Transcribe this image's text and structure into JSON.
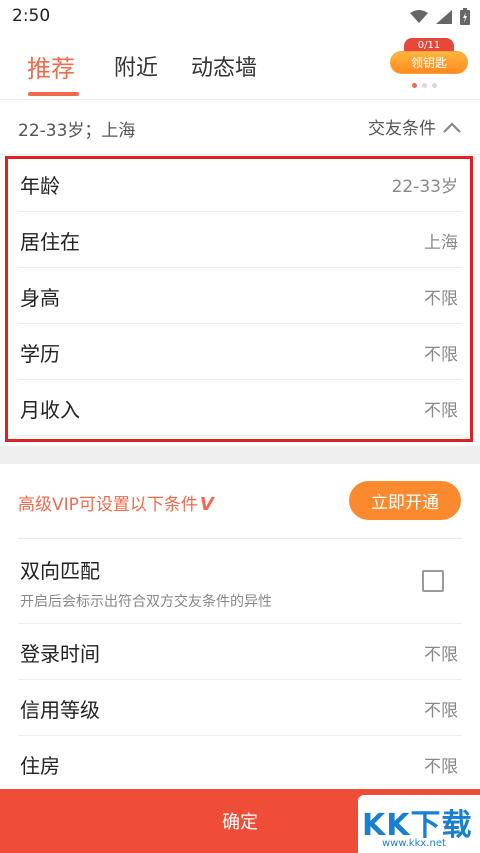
{
  "status_bar": {
    "time": "2:50",
    "icons": [
      "wifi-icon",
      "signal-icon",
      "battery-icon"
    ]
  },
  "tabs": [
    {
      "label": "推荐",
      "active": true
    },
    {
      "label": "附近",
      "active": false
    },
    {
      "label": "动态墙",
      "active": false
    }
  ],
  "badge": {
    "count": "0/11",
    "label": "领钥匙"
  },
  "filter_bar": {
    "summary": "22-33岁；上海",
    "toggle_label": "交友条件",
    "toggle_icon": "chevron-up-icon"
  },
  "basic_conditions": [
    {
      "label": "年龄",
      "value": "22-33岁"
    },
    {
      "label": "居住在",
      "value": "上海"
    },
    {
      "label": "身高",
      "value": "不限"
    },
    {
      "label": "学历",
      "value": "不限"
    },
    {
      "label": "月收入",
      "value": "不限"
    }
  ],
  "vip_section": {
    "title": "高级VIP可设置以下条件",
    "mark": "V",
    "button_label": "立即开通",
    "match": {
      "label": "双向匹配",
      "desc": "开启后会标示出符合双方交友条件的异性",
      "checked": false
    },
    "items": [
      {
        "label": "登录时间",
        "value": "不限"
      },
      {
        "label": "信用等级",
        "value": "不限"
      },
      {
        "label": "住房",
        "value": "不限"
      }
    ]
  },
  "confirm_label": "确定",
  "watermark": {
    "main": "KK下载",
    "sub": "www.kkx.net"
  },
  "colors": {
    "accent": "#f26a4d",
    "button_orange": "#fb8a2e",
    "confirm_red": "#f04d38",
    "highlight_border": "#e02020"
  }
}
